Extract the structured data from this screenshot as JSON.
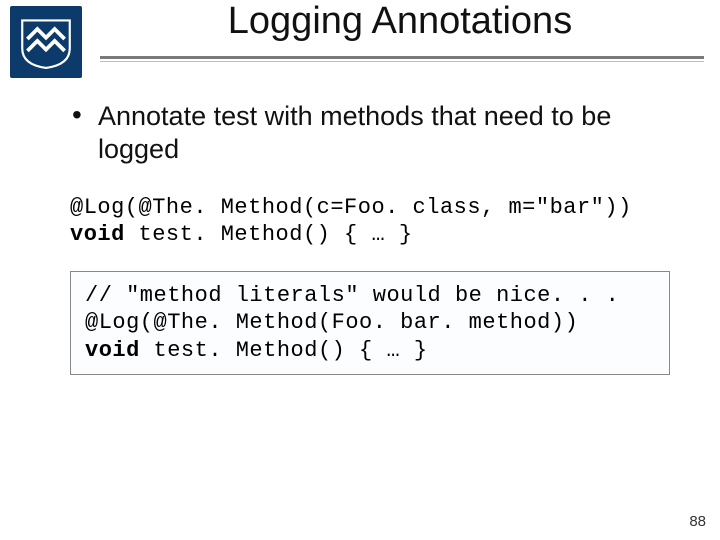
{
  "title": "Logging Annotations",
  "bullet": "Annotate test with methods that need to be logged",
  "code1": {
    "line1": "@Log(@The. Method(c=Foo. class, m=\"bar\"))",
    "kw": "void",
    "line2_rest": " test. Method() { … }"
  },
  "code2": {
    "line1": "// \"method literals\" would be nice. . .",
    "line2": "@Log(@The. Method(Foo. bar. method))",
    "kw": "void",
    "line3_rest": " test. Method() { … }"
  },
  "page_number": "88"
}
